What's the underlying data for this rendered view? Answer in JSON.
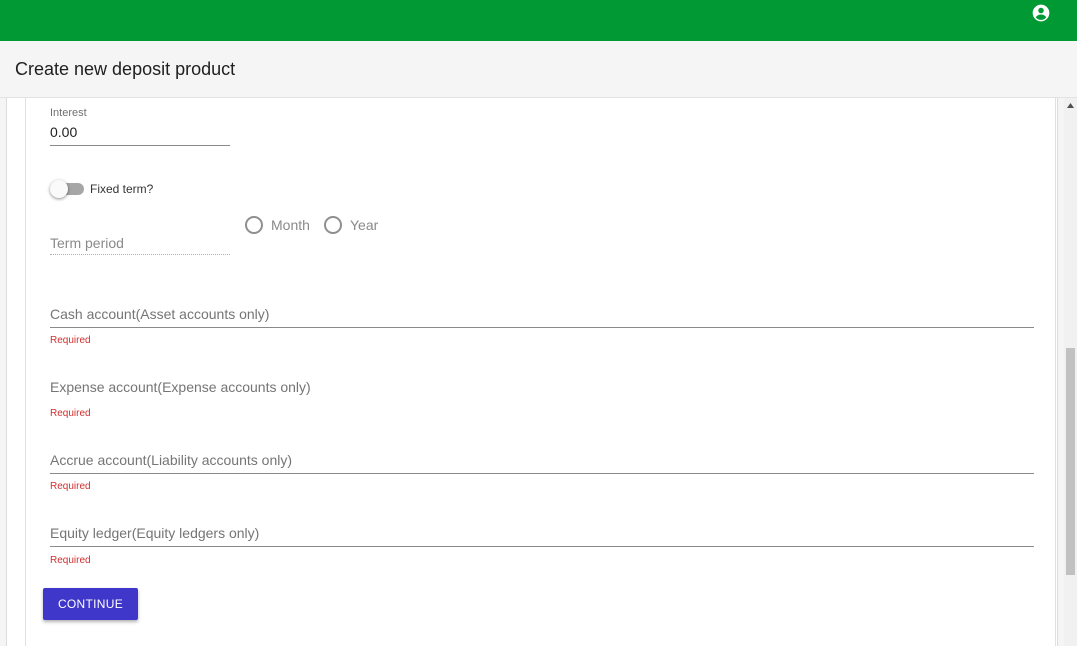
{
  "header": {
    "bar_color": "#009933",
    "account_icon": "account-circle-icon"
  },
  "page": {
    "title": "Create new deposit product"
  },
  "form": {
    "interest": {
      "label": "Interest",
      "value": "0.00"
    },
    "fixed_term": {
      "label": "Fixed term?",
      "checked": false
    },
    "term_period": {
      "label": "Term period",
      "options": [
        "Month",
        "Year"
      ]
    },
    "cash_account": {
      "placeholder": "Cash account(Asset accounts only)",
      "error": "Required"
    },
    "expense_account": {
      "placeholder": "Expense account(Expense accounts only)",
      "error": "Required"
    },
    "accrue_account": {
      "placeholder": "Accrue account(Liability accounts only)",
      "error": "Required"
    },
    "equity_ledger": {
      "placeholder": "Equity ledger(Equity ledgers only)",
      "error": "Required"
    },
    "continue_label": "CONTINUE"
  },
  "colors": {
    "primary_button": "#3f37c9",
    "error": "#d32f2f"
  }
}
